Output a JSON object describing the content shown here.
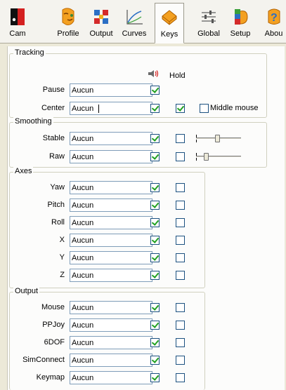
{
  "toolbar": {
    "items": [
      {
        "label": "Cam",
        "icon": "camera-icon"
      },
      {
        "label": "Profile",
        "icon": "profile-face-icon"
      },
      {
        "label": "Output",
        "icon": "output-grid-icon"
      },
      {
        "label": "Curves",
        "icon": "curves-graph-icon"
      },
      {
        "label": "Keys",
        "icon": "keys-icon",
        "active": true
      },
      {
        "label": "Global",
        "icon": "global-sliders-icon"
      },
      {
        "label": "Setup",
        "icon": "setup-wizard-icon"
      },
      {
        "label": "Abou",
        "icon": "about-help-icon"
      }
    ]
  },
  "tracking": {
    "title": "Tracking",
    "hold_label": "Hold",
    "rows": [
      {
        "label": "Pause",
        "value": "Aucun",
        "sound_checked": true
      },
      {
        "label": "Center",
        "value": "Aucun",
        "sound_checked": true,
        "hold_checked": true,
        "middle_mouse_label": "Middle mouse",
        "middle_mouse_checked": false
      }
    ]
  },
  "smoothing": {
    "title": "Smoothing",
    "rows": [
      {
        "label": "Stable",
        "value": "Aucun",
        "sound_checked": true,
        "hold_checked": false,
        "slider_level": 0.48
      },
      {
        "label": "Raw",
        "value": "Aucun",
        "sound_checked": true,
        "hold_checked": false,
        "slider_level": 0.2
      }
    ]
  },
  "axes": {
    "title": "Axes",
    "rows": [
      {
        "label": "Yaw",
        "value": "Aucun",
        "sound_checked": true,
        "hold_checked": false
      },
      {
        "label": "Pitch",
        "value": "Aucun",
        "sound_checked": true,
        "hold_checked": false
      },
      {
        "label": "Roll",
        "value": "Aucun",
        "sound_checked": true,
        "hold_checked": false
      },
      {
        "label": "X",
        "value": "Aucun",
        "sound_checked": true,
        "hold_checked": false
      },
      {
        "label": "Y",
        "value": "Aucun",
        "sound_checked": true,
        "hold_checked": false
      },
      {
        "label": "Z",
        "value": "Aucun",
        "sound_checked": true,
        "hold_checked": false
      }
    ]
  },
  "output": {
    "title": "Output",
    "rows": [
      {
        "label": "Mouse",
        "value": "Aucun",
        "sound_checked": true,
        "hold_checked": false
      },
      {
        "label": "PPJoy",
        "value": "Aucun",
        "sound_checked": true,
        "hold_checked": false
      },
      {
        "label": "6DOF",
        "value": "Aucun",
        "sound_checked": true,
        "hold_checked": false
      },
      {
        "label": "SimConnect",
        "value": "Aucun",
        "sound_checked": true,
        "hold_checked": false
      },
      {
        "label": "Keymap",
        "value": "Aucun",
        "sound_checked": true,
        "hold_checked": false
      }
    ]
  },
  "colors": {
    "checkmark": "#21a121",
    "checkbox_border": "#1c5180",
    "field_border": "#7f9db9",
    "group_border": "#d0d0bf"
  }
}
